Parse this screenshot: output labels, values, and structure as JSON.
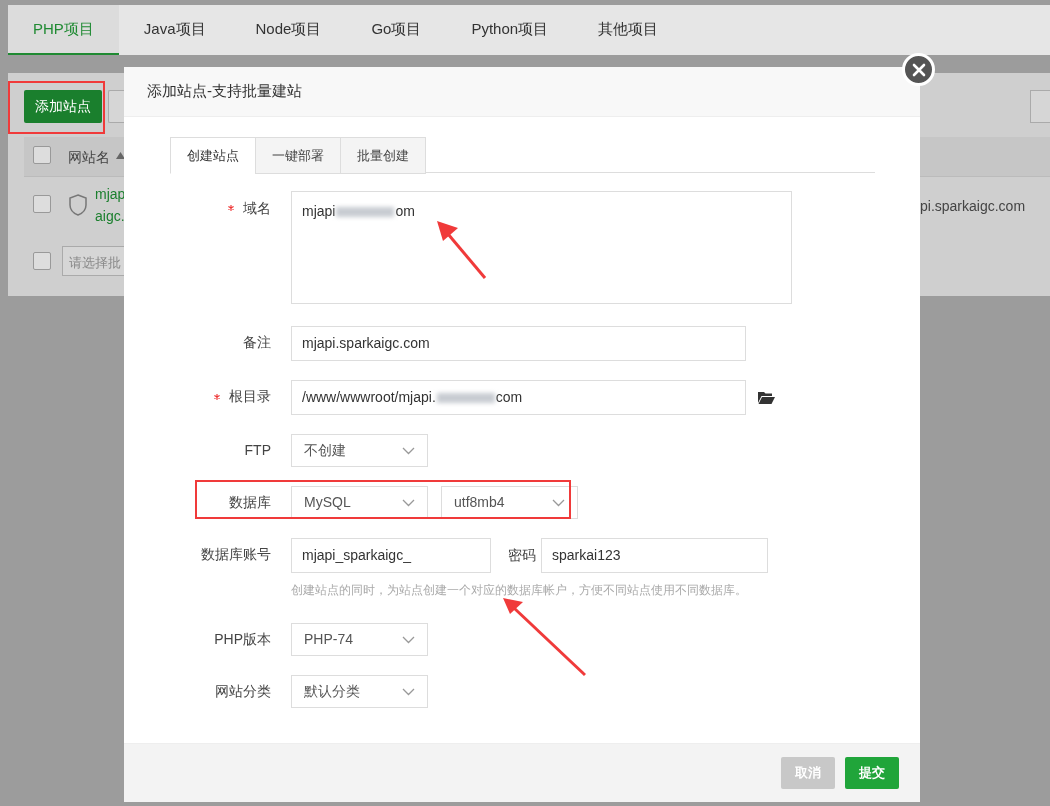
{
  "project_tabs": [
    {
      "label": "PHP项目",
      "selected": true
    },
    {
      "label": "Java项目",
      "selected": false
    },
    {
      "label": "Node项目",
      "selected": false
    },
    {
      "label": "Go项目",
      "selected": false
    },
    {
      "label": "Python项目",
      "selected": false
    },
    {
      "label": "其他项目",
      "selected": false
    }
  ],
  "toolbar": {
    "add_site_button": "添加站点"
  },
  "site_table": {
    "header_checked": false,
    "columns": [
      "网站名"
    ],
    "rows": [
      {
        "checked": false,
        "name_lines": [
          "mjap",
          "aigc."
        ],
        "column_partial": "pi.sparkaigc.com"
      }
    ]
  },
  "batch_select": {
    "checked": false,
    "placeholder": "请选择批"
  },
  "dialog": {
    "title": "添加站点-支持批量建站",
    "tabs": [
      {
        "label": "创建站点",
        "selected": true
      },
      {
        "label": "一键部署",
        "selected": false
      },
      {
        "label": "批量创建",
        "selected": false
      }
    ],
    "fields": [
      {
        "kind": "textarea",
        "label": "域名",
        "required": true,
        "value": "mjapi",
        "value_tail": "om",
        "redacted": true
      },
      {
        "kind": "input",
        "label": "备注",
        "required": false,
        "value": "mjapi.sparkaigc.com"
      },
      {
        "kind": "path",
        "label": "根目录",
        "required": true,
        "value": "/www/wwwroot/mjapi.",
        "value_tail": "com",
        "redacted": true
      },
      {
        "kind": "select",
        "label": "FTP",
        "required": false,
        "value": "不创建"
      },
      {
        "kind": "select_pair",
        "label": "数据库",
        "required": false,
        "value": "MySQL",
        "second_value": "utf8mb4"
      },
      {
        "kind": "input_pair",
        "label": "数据库账号",
        "required": false,
        "value": "mjapi_sparkaigc_",
        "second_label": "密码",
        "second_value": "sparkai123",
        "hint": "创建站点的同时，为站点创建一个对应的数据库帐户，方便不同站点使用不同数据库。"
      },
      {
        "kind": "select",
        "label": "PHP版本",
        "required": false,
        "value": "PHP-74"
      },
      {
        "kind": "select",
        "label": "网站分类",
        "required": false,
        "value": "默认分类"
      }
    ],
    "buttons": [
      {
        "kind": "cancel",
        "label": "取消"
      },
      {
        "kind": "submit",
        "label": "提交"
      }
    ]
  }
}
